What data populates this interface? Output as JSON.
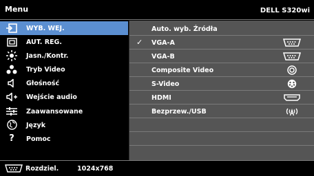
{
  "header": {
    "title": "Menu",
    "model": "DELL S320wi"
  },
  "menu": {
    "items": [
      {
        "label": "WYB. WEJ.",
        "icon": "input-select-icon",
        "selected": true
      },
      {
        "label": "AUT. REG.",
        "icon": "auto-adjust-icon"
      },
      {
        "label": "Jasn./Kontr.",
        "icon": "brightness-icon"
      },
      {
        "label": "Tryb Video",
        "icon": "video-mode-icon"
      },
      {
        "label": "Głośność",
        "icon": "speaker-icon"
      },
      {
        "label": "Wejście audio",
        "icon": "audio-input-icon"
      },
      {
        "label": "Zaawansowane",
        "icon": "advanced-settings-icon"
      },
      {
        "label": "Język",
        "icon": "language-globe-icon"
      },
      {
        "label": "Pomoc",
        "icon": "help-icon"
      }
    ]
  },
  "submenu": {
    "heading": "Auto. wyb. Źródła",
    "checkmark": "✓",
    "items": [
      {
        "label": "VGA-A",
        "icon": "vga-connector-icon",
        "checked": true
      },
      {
        "label": "VGA-B",
        "icon": "vga-connector-icon"
      },
      {
        "label": "Composite Video",
        "icon": "composite-connector-icon"
      },
      {
        "label": "S-Video",
        "icon": "svideo-connector-icon"
      },
      {
        "label": "HDMI",
        "icon": "hdmi-connector-icon"
      },
      {
        "label": "Bezprzew./USB",
        "icon": "wireless-icon"
      }
    ]
  },
  "footer": {
    "icon": "vga-connector-icon",
    "label": "Rozdziel.",
    "value": "1024x768"
  }
}
